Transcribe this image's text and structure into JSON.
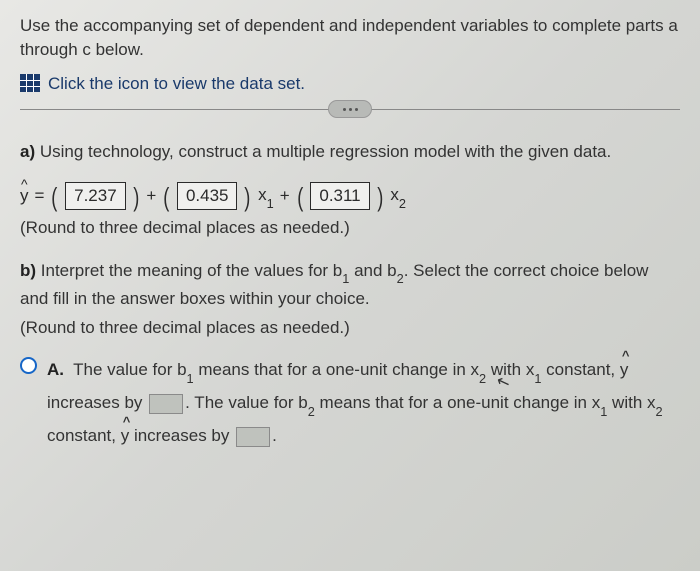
{
  "intro": "Use the accompanying set of dependent and independent variables to complete parts a through c below.",
  "link_text": "Click the icon to view the data set.",
  "part_a": {
    "label": "a)",
    "text": "Using technology, construct a multiple regression model with the given data."
  },
  "equation": {
    "lhs": "y",
    "eq": "=",
    "v1": "7.237",
    "plus": "+",
    "v2": "0.435",
    "x1": "x",
    "s1": "1",
    "v3": "0.311",
    "x2": "x",
    "s2": "2"
  },
  "round_note": "(Round to three decimal places as needed.)",
  "part_b": {
    "label": "b)",
    "line1_a": "Interpret the meaning of the values for b",
    "line1_b": " and b",
    "line1_c": ". Select the correct choice below and fill in the answer boxes within your choice.",
    "sub1": "1",
    "sub2": "2"
  },
  "choice_a": {
    "letter": "A.",
    "t1": "The value for b",
    "t2": " means that for a one-unit change in x",
    "t3": " with x",
    "t4": " constant, y increases by ",
    "t5": ". The value for b",
    "t6": " means that for a one-unit change in x",
    "t7": " with x",
    "t8": " constant, y increases by ",
    "t9": "."
  }
}
